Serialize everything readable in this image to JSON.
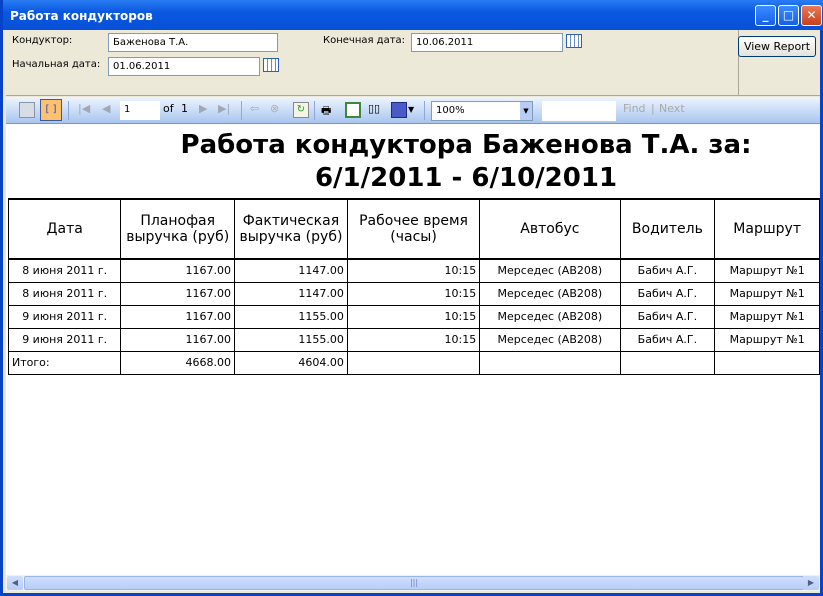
{
  "window": {
    "title": "Работа кондукторов"
  },
  "params": {
    "conductor_label": "Кондуктор:",
    "conductor_value": "Баженова Т.А.",
    "start_label": "Начальная дата:",
    "start_value": "01.06.2011",
    "end_label": "Конечная дата:",
    "end_value": "10.06.2011",
    "view_report": "View Report"
  },
  "toolbar": {
    "page": "1",
    "of_label": "of",
    "total_pages": "1",
    "zoom": "100%",
    "find_value": "",
    "find": "Find",
    "separator": "|",
    "next": "Next"
  },
  "report": {
    "title_line1": "Работа кондуктора Баженова Т.А. за:",
    "title_line2": "6/1/2011 - 6/10/2011",
    "headers": [
      "Дата",
      "Планофая выручка (руб)",
      "Фактическая выручка (руб)",
      "Рабочее время (часы)",
      "Автобус",
      "Водитель",
      "Маршрут"
    ],
    "rows": [
      [
        "8 июня 2011 г.",
        "1167.00",
        "1147.00",
        "10:15",
        "Мерседес (АВ208)",
        "Бабич А.Г.",
        "Маршрут №1"
      ],
      [
        "8 июня 2011 г.",
        "1167.00",
        "1147.00",
        "10:15",
        "Мерседес (АВ208)",
        "Бабич А.Г.",
        "Маршрут №1"
      ],
      [
        "9 июня 2011 г.",
        "1167.00",
        "1155.00",
        "10:15",
        "Мерседес (АВ208)",
        "Бабич А.Г.",
        "Маршрут №1"
      ],
      [
        "9 июня 2011 г.",
        "1167.00",
        "1155.00",
        "10:15",
        "Мерседес (АВ208)",
        "Бабич А.Г.",
        "Маршрут №1"
      ]
    ],
    "total": {
      "label": "Итого:",
      "plan": "4668.00",
      "fact": "4604.00"
    }
  }
}
